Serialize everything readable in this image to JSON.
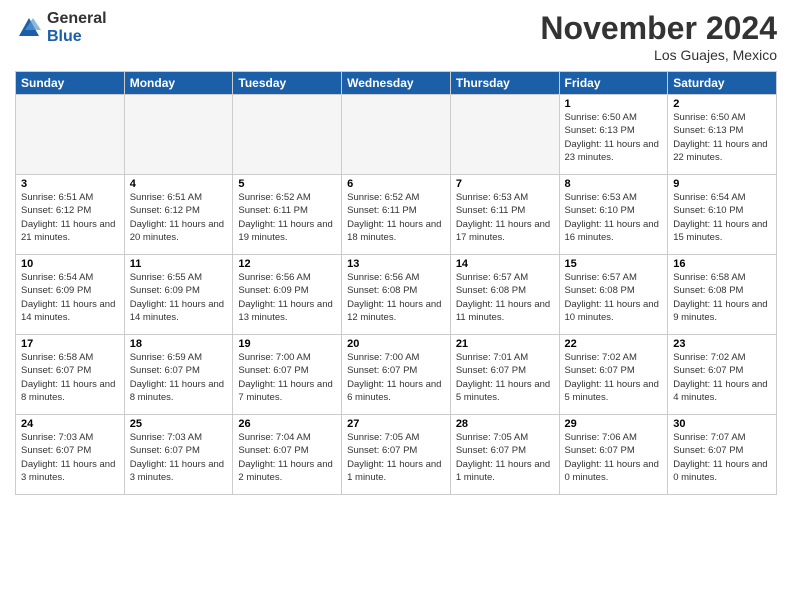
{
  "logo": {
    "general": "General",
    "blue": "Blue"
  },
  "header": {
    "title": "November 2024",
    "location": "Los Guajes, Mexico"
  },
  "weekdays": [
    "Sunday",
    "Monday",
    "Tuesday",
    "Wednesday",
    "Thursday",
    "Friday",
    "Saturday"
  ],
  "weeks": [
    [
      {
        "day": "",
        "empty": true
      },
      {
        "day": "",
        "empty": true
      },
      {
        "day": "",
        "empty": true
      },
      {
        "day": "",
        "empty": true
      },
      {
        "day": "",
        "empty": true
      },
      {
        "day": "1",
        "sunrise": "Sunrise: 6:50 AM",
        "sunset": "Sunset: 6:13 PM",
        "daylight": "Daylight: 11 hours and 23 minutes."
      },
      {
        "day": "2",
        "sunrise": "Sunrise: 6:50 AM",
        "sunset": "Sunset: 6:13 PM",
        "daylight": "Daylight: 11 hours and 22 minutes."
      }
    ],
    [
      {
        "day": "3",
        "sunrise": "Sunrise: 6:51 AM",
        "sunset": "Sunset: 6:12 PM",
        "daylight": "Daylight: 11 hours and 21 minutes."
      },
      {
        "day": "4",
        "sunrise": "Sunrise: 6:51 AM",
        "sunset": "Sunset: 6:12 PM",
        "daylight": "Daylight: 11 hours and 20 minutes."
      },
      {
        "day": "5",
        "sunrise": "Sunrise: 6:52 AM",
        "sunset": "Sunset: 6:11 PM",
        "daylight": "Daylight: 11 hours and 19 minutes."
      },
      {
        "day": "6",
        "sunrise": "Sunrise: 6:52 AM",
        "sunset": "Sunset: 6:11 PM",
        "daylight": "Daylight: 11 hours and 18 minutes."
      },
      {
        "day": "7",
        "sunrise": "Sunrise: 6:53 AM",
        "sunset": "Sunset: 6:11 PM",
        "daylight": "Daylight: 11 hours and 17 minutes."
      },
      {
        "day": "8",
        "sunrise": "Sunrise: 6:53 AM",
        "sunset": "Sunset: 6:10 PM",
        "daylight": "Daylight: 11 hours and 16 minutes."
      },
      {
        "day": "9",
        "sunrise": "Sunrise: 6:54 AM",
        "sunset": "Sunset: 6:10 PM",
        "daylight": "Daylight: 11 hours and 15 minutes."
      }
    ],
    [
      {
        "day": "10",
        "sunrise": "Sunrise: 6:54 AM",
        "sunset": "Sunset: 6:09 PM",
        "daylight": "Daylight: 11 hours and 14 minutes."
      },
      {
        "day": "11",
        "sunrise": "Sunrise: 6:55 AM",
        "sunset": "Sunset: 6:09 PM",
        "daylight": "Daylight: 11 hours and 14 minutes."
      },
      {
        "day": "12",
        "sunrise": "Sunrise: 6:56 AM",
        "sunset": "Sunset: 6:09 PM",
        "daylight": "Daylight: 11 hours and 13 minutes."
      },
      {
        "day": "13",
        "sunrise": "Sunrise: 6:56 AM",
        "sunset": "Sunset: 6:08 PM",
        "daylight": "Daylight: 11 hours and 12 minutes."
      },
      {
        "day": "14",
        "sunrise": "Sunrise: 6:57 AM",
        "sunset": "Sunset: 6:08 PM",
        "daylight": "Daylight: 11 hours and 11 minutes."
      },
      {
        "day": "15",
        "sunrise": "Sunrise: 6:57 AM",
        "sunset": "Sunset: 6:08 PM",
        "daylight": "Daylight: 11 hours and 10 minutes."
      },
      {
        "day": "16",
        "sunrise": "Sunrise: 6:58 AM",
        "sunset": "Sunset: 6:08 PM",
        "daylight": "Daylight: 11 hours and 9 minutes."
      }
    ],
    [
      {
        "day": "17",
        "sunrise": "Sunrise: 6:58 AM",
        "sunset": "Sunset: 6:07 PM",
        "daylight": "Daylight: 11 hours and 8 minutes."
      },
      {
        "day": "18",
        "sunrise": "Sunrise: 6:59 AM",
        "sunset": "Sunset: 6:07 PM",
        "daylight": "Daylight: 11 hours and 8 minutes."
      },
      {
        "day": "19",
        "sunrise": "Sunrise: 7:00 AM",
        "sunset": "Sunset: 6:07 PM",
        "daylight": "Daylight: 11 hours and 7 minutes."
      },
      {
        "day": "20",
        "sunrise": "Sunrise: 7:00 AM",
        "sunset": "Sunset: 6:07 PM",
        "daylight": "Daylight: 11 hours and 6 minutes."
      },
      {
        "day": "21",
        "sunrise": "Sunrise: 7:01 AM",
        "sunset": "Sunset: 6:07 PM",
        "daylight": "Daylight: 11 hours and 5 minutes."
      },
      {
        "day": "22",
        "sunrise": "Sunrise: 7:02 AM",
        "sunset": "Sunset: 6:07 PM",
        "daylight": "Daylight: 11 hours and 5 minutes."
      },
      {
        "day": "23",
        "sunrise": "Sunrise: 7:02 AM",
        "sunset": "Sunset: 6:07 PM",
        "daylight": "Daylight: 11 hours and 4 minutes."
      }
    ],
    [
      {
        "day": "24",
        "sunrise": "Sunrise: 7:03 AM",
        "sunset": "Sunset: 6:07 PM",
        "daylight": "Daylight: 11 hours and 3 minutes."
      },
      {
        "day": "25",
        "sunrise": "Sunrise: 7:03 AM",
        "sunset": "Sunset: 6:07 PM",
        "daylight": "Daylight: 11 hours and 3 minutes."
      },
      {
        "day": "26",
        "sunrise": "Sunrise: 7:04 AM",
        "sunset": "Sunset: 6:07 PM",
        "daylight": "Daylight: 11 hours and 2 minutes."
      },
      {
        "day": "27",
        "sunrise": "Sunrise: 7:05 AM",
        "sunset": "Sunset: 6:07 PM",
        "daylight": "Daylight: 11 hours and 1 minute."
      },
      {
        "day": "28",
        "sunrise": "Sunrise: 7:05 AM",
        "sunset": "Sunset: 6:07 PM",
        "daylight": "Daylight: 11 hours and 1 minute."
      },
      {
        "day": "29",
        "sunrise": "Sunrise: 7:06 AM",
        "sunset": "Sunset: 6:07 PM",
        "daylight": "Daylight: 11 hours and 0 minutes."
      },
      {
        "day": "30",
        "sunrise": "Sunrise: 7:07 AM",
        "sunset": "Sunset: 6:07 PM",
        "daylight": "Daylight: 11 hours and 0 minutes."
      }
    ]
  ]
}
